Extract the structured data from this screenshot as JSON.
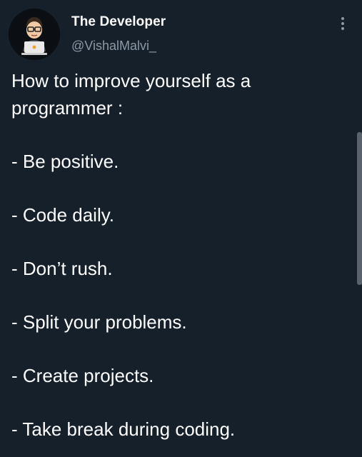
{
  "author": {
    "display_name": "The Developer",
    "handle": "@VishalMalvi_",
    "avatar_icon": "developer-cartoon-avatar"
  },
  "actions": {
    "more_icon": "more-vertical-icon"
  },
  "tweet": {
    "intro": "How to improve yourself as a programmer :",
    "tips": [
      "- Be positive.",
      "- Code daily.",
      "- Don’t rush.",
      "- Split your problems.",
      "- Create projects.",
      "- Take break during coding."
    ]
  },
  "colors": {
    "background": "#15202b",
    "text_primary": "#ffffff",
    "text_secondary": "#8b98a5"
  }
}
